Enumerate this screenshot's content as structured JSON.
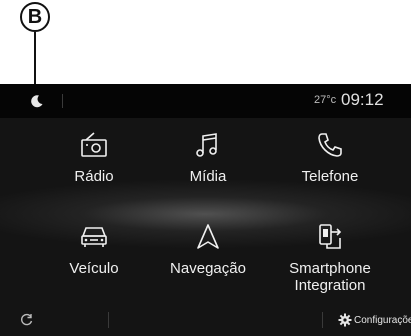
{
  "callout": {
    "letter": "B"
  },
  "status": {
    "temperature": "27°c",
    "time": "09:12"
  },
  "apps": [
    {
      "label": "Rádio",
      "icon": "radio-icon"
    },
    {
      "label": "Mídia",
      "icon": "music-note-icon"
    },
    {
      "label": "Telefone",
      "icon": "phone-icon"
    },
    {
      "label": "Veículo",
      "icon": "car-icon"
    },
    {
      "label": "Navegação",
      "icon": "navigation-arrow-icon"
    },
    {
      "label": "Smartphone Integration",
      "icon": "smartphone-projection-icon"
    }
  ],
  "bottom": {
    "settings_label": "Configuraçõe"
  },
  "colors": {
    "screen_bg": "#141414",
    "status_bg": "#050505",
    "text": "#f0f0f0"
  }
}
